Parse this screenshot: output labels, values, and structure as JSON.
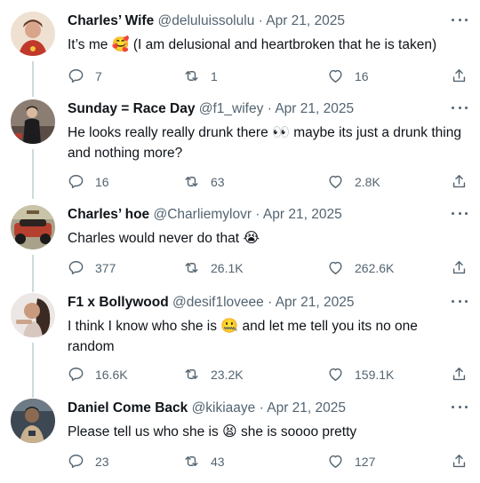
{
  "tweets": [
    {
      "name": "Charles’ Wife",
      "handle": "@deluluissolulu",
      "sep": "·",
      "date": "Apr 21, 2025",
      "text_before": "It’s me ",
      "emoji": "🥰",
      "text_after": " (I am delusional and heartbroken that he is taken)",
      "replies": "7",
      "retweets": "1",
      "likes": "16",
      "avatar_icon": "avatar-portrait",
      "avatar_colors": [
        "#e9d4c2",
        "#c0392b"
      ]
    },
    {
      "name": "Sunday = Race Day",
      "handle": "@f1_wifey",
      "sep": "·",
      "date": "Apr 21, 2025",
      "text_before": "He looks really really drunk there ",
      "emoji": "👀",
      "text_after": " maybe its just a drunk thing and nothing more?",
      "replies": "16",
      "retweets": "63",
      "likes": "2.8K",
      "avatar_icon": "avatar-portrait",
      "avatar_colors": [
        "#3a2e2a",
        "#9a8a80"
      ]
    },
    {
      "name": "Charles’ hoe",
      "handle": "@Charliemylovr",
      "sep": "·",
      "date": "Apr 21, 2025",
      "text_before": "Charles would never do that ",
      "emoji": "😭",
      "text_after": "",
      "replies": "377",
      "retweets": "26.1K",
      "likes": "262.6K",
      "avatar_icon": "avatar-car",
      "avatar_colors": [
        "#6b5a3a",
        "#b5402e"
      ]
    },
    {
      "name": "F1 x Bollywood",
      "handle": "@desif1loveee",
      "sep": "·",
      "date": "Apr 21, 2025",
      "text_before": "I think I know who she is ",
      "emoji": "🤐",
      "text_after": " and let me tell you its no one random",
      "replies": "16.6K",
      "retweets": "23.2K",
      "likes": "159.1K",
      "avatar_icon": "avatar-portrait",
      "avatar_colors": [
        "#ede6e2",
        "#6a4a3a"
      ]
    },
    {
      "name": "Daniel Come Back",
      "handle": "@kikiaaye",
      "sep": "·",
      "date": "Apr 21, 2025",
      "text_before": "Please tell us who she is ",
      "emoji": "😫",
      "text_after": " she is soooo pretty",
      "replies": "23",
      "retweets": "43",
      "likes": "127",
      "avatar_icon": "avatar-portrait",
      "avatar_colors": [
        "#2f3a44",
        "#c9b08f"
      ]
    }
  ]
}
